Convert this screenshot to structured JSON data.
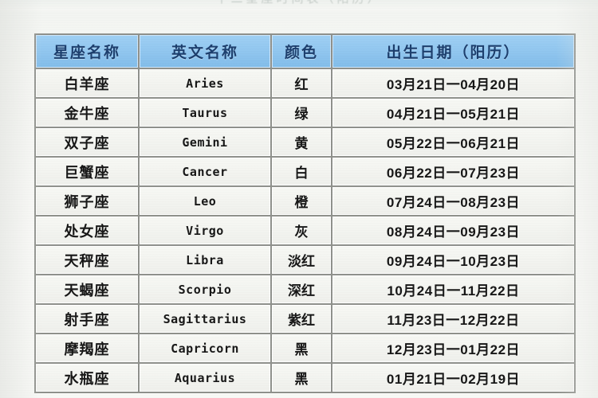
{
  "document": {
    "title_strip_ghost": "十二星座时间表（阳历）"
  },
  "table": {
    "columns": [
      {
        "key": "name",
        "label": "星座名称"
      },
      {
        "key": "en",
        "label": "英文名称"
      },
      {
        "key": "color",
        "label": "颜色"
      },
      {
        "key": "date",
        "label": "出生日期（阳历）"
      }
    ],
    "rows": [
      {
        "name": "白羊座",
        "en": "Aries",
        "color": "红",
        "date": "03月21日一04月20日"
      },
      {
        "name": "金牛座",
        "en": "Taurus",
        "color": "绿",
        "date": "04月21日一05月21日"
      },
      {
        "name": "双子座",
        "en": "Gemini",
        "color": "黄",
        "date": "05月22日一06月21日"
      },
      {
        "name": "巨蟹座",
        "en": "Cancer",
        "color": "白",
        "date": "06月22日一07月23日"
      },
      {
        "name": "狮子座",
        "en": "Leo",
        "color": "橙",
        "date": "07月24日一08月23日"
      },
      {
        "name": "处女座",
        "en": "Virgo",
        "color": "灰",
        "date": "08月24日一09月23日"
      },
      {
        "name": "天秤座",
        "en": "Libra",
        "color": "淡红",
        "date": "09月24日一10月23日"
      },
      {
        "name": "天蝎座",
        "en": "Scorpio",
        "color": "深红",
        "date": "10月24日一11月22日"
      },
      {
        "name": "射手座",
        "en": "Sagittarius",
        "color": "紫红",
        "date": "11月23日一12月22日"
      },
      {
        "name": "摩羯座",
        "en": "Capricorn",
        "color": "黑",
        "date": "12月23日一01月22日"
      },
      {
        "name": "水瓶座",
        "en": "Aquarius",
        "color": "黑",
        "date": "01月21日一02月19日"
      }
    ]
  },
  "colors": {
    "header_fill": "#8fc6f0",
    "header_text": "#1d3f6e",
    "cell_fill": "#f4f5f1",
    "cell_text": "#171717",
    "grid_line": "#8f918c",
    "page_background": "#f7f8f5"
  }
}
